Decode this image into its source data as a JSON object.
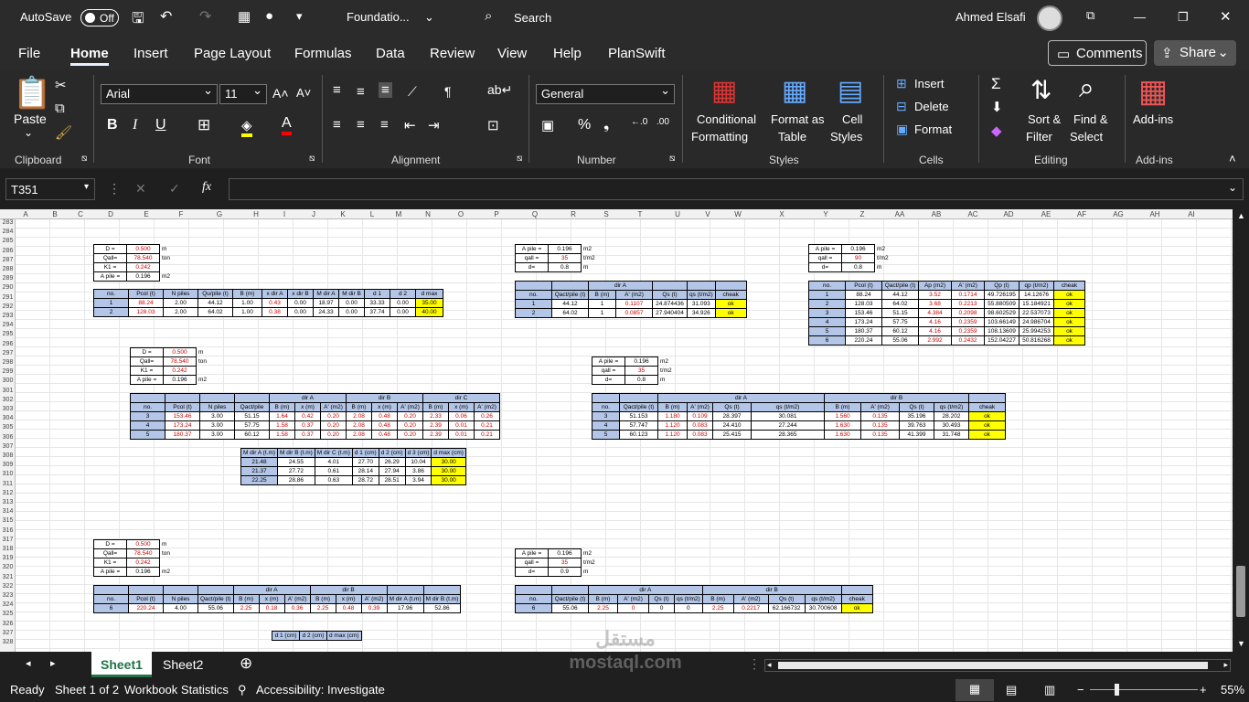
{
  "titlebar": {
    "autosave": "AutoSave",
    "toggle": "Off",
    "filename": "Foundatio...",
    "search": "Search",
    "user": "Ahmed Elsafi"
  },
  "menu": [
    "File",
    "Home",
    "Insert",
    "Page Layout",
    "Formulas",
    "Data",
    "Review",
    "View",
    "Help",
    "PlanSwift"
  ],
  "comments": "Comments",
  "share": "Share",
  "ribbon": {
    "paste": "Paste",
    "clipboard": "Clipboard",
    "font_name": "Arial",
    "font_size": "11",
    "font": "Font",
    "alignment": "Alignment",
    "number_format": "General",
    "number": "Number",
    "cond1": "Conditional",
    "cond2": "Formatting",
    "fmt1": "Format as",
    "fmt2": "Table",
    "cell1": "Cell",
    "cell2": "Styles",
    "styles": "Styles",
    "insert": "Insert",
    "delete": "Delete",
    "format": "Format",
    "cells": "Cells",
    "sort1": "Sort &",
    "sort2": "Filter",
    "find1": "Find &",
    "find2": "Select",
    "editing": "Editing",
    "addins": "Add-ins",
    "addins_group": "Add-ins"
  },
  "namebox": "T351",
  "fx": "fx",
  "columns": [
    "A",
    "B",
    "C",
    "D",
    "E",
    "F",
    "G",
    "H",
    "I",
    "J",
    "K",
    "L",
    "M",
    "N",
    "O",
    "P",
    "Q",
    "R",
    "S",
    "T",
    "U",
    "V",
    "W",
    "X",
    "Y",
    "Z",
    "AA",
    "AB",
    "AC",
    "AD",
    "AE",
    "AF",
    "AG",
    "AH",
    "AI"
  ],
  "rows": [
    "283",
    "284",
    "285",
    "286",
    "287",
    "288",
    "289",
    "290",
    "291",
    "292",
    "293",
    "294",
    "295",
    "296",
    "297",
    "298",
    "299",
    "300",
    "301",
    "302",
    "303",
    "304",
    "305",
    "306",
    "307",
    "308",
    "309",
    "310",
    "311",
    "312",
    "313",
    "314",
    "315",
    "316",
    "317",
    "318",
    "319",
    "320",
    "321",
    "322",
    "323",
    "324",
    "325",
    "326",
    "327",
    "328"
  ],
  "blocks": {
    "b1": {
      "labels": [
        "D =",
        "Qall=",
        "K1 =",
        "A pile ="
      ],
      "values": [
        "0.500",
        "78.540",
        "0.242",
        "0.196"
      ],
      "units": [
        "m",
        "ton",
        "",
        "m2"
      ]
    },
    "t1h": [
      "no.",
      "Pcol (t)",
      "N piles",
      "Qu/pile (t)",
      "B (m)",
      "x dir A",
      "x dir B",
      "M dir A",
      "M dir B",
      "d 1",
      "d 2",
      "d max"
    ],
    "t1": [
      [
        "1",
        "88.24",
        "2.00",
        "44.12",
        "1.00",
        "0.43",
        "0.00",
        "18.97",
        "0.00",
        "33.33",
        "0.00",
        "35.00"
      ],
      [
        "2",
        "128.03",
        "2.00",
        "64.02",
        "1.00",
        "0.38",
        "0.00",
        "24.33",
        "0.00",
        "37.74",
        "0.00",
        "40.00"
      ]
    ],
    "b2": {
      "labels": [
        "A pile =",
        "qall =",
        "d="
      ],
      "values": [
        "0.196",
        "35",
        "0.8"
      ],
      "units": [
        "m2",
        "t/m2",
        "m"
      ]
    },
    "t2h": [
      "no.",
      "Qact/pile (t)",
      "B (m)",
      "A' (m2)",
      "Qs (t)",
      "qs (t/m2)",
      "cheak"
    ],
    "t2": [
      [
        "1",
        "44.12",
        "1",
        "0.1107",
        "24.874436",
        "31.093",
        "ok"
      ],
      [
        "2",
        "64.02",
        "1",
        "0.0857",
        "27.940404",
        "34.926",
        "ok"
      ]
    ],
    "b3": {
      "labels": [
        "A pile =",
        "qall =",
        "d="
      ],
      "values": [
        "0.196",
        "90",
        "0.8"
      ],
      "units": [
        "m2",
        "t/m2",
        "m"
      ]
    },
    "t3h": [
      "no.",
      "Pcol (t)",
      "Qact/pile (t)",
      "Ap (m2)",
      "A' (m2)",
      "Qp (t)",
      "qp (t/m2)",
      "cheak"
    ],
    "t3": [
      [
        "1",
        "88.24",
        "44.12",
        "3.52",
        "0.1714",
        "49.726195",
        "14.12676",
        "ok"
      ],
      [
        "2",
        "128.03",
        "64.02",
        "3.68",
        "0.2213",
        "55.880509",
        "15.184921",
        "ok"
      ],
      [
        "3",
        "153.46",
        "51.15",
        "4.384",
        "0.2098",
        "98.602529",
        "22.537073",
        "ok"
      ],
      [
        "4",
        "173.24",
        "57.75",
        "4.16",
        "0.2359",
        "103.66149",
        "24.986704",
        "ok"
      ],
      [
        "5",
        "180.37",
        "60.12",
        "4.16",
        "0.2359",
        "108.13609",
        "25.994253",
        "ok"
      ],
      [
        "6",
        "220.24",
        "55.06",
        "2.992",
        "0.2432",
        "152.04227",
        "50.816268",
        "ok"
      ]
    ],
    "b4": {
      "labels": [
        "D =",
        "Qall=",
        "K1 =",
        "A pile ="
      ],
      "values": [
        "0.500",
        "78.540",
        "0.242",
        "0.196"
      ],
      "units": [
        "m",
        "ton",
        "",
        "m2"
      ]
    },
    "t4h": [
      "no.",
      "Pcol (t)",
      "N piles",
      "Qact/pile",
      "B (m)",
      "x (m)",
      "A' (m2)",
      "B (m)",
      "x (m)",
      "A' (m2)",
      "B (m)",
      "x (m)",
      "A' (m2)"
    ],
    "t4": [
      [
        "3",
        "153.46",
        "3.00",
        "51.15",
        "1.64",
        "0.42",
        "0.20",
        "2.08",
        "0.48",
        "0.20",
        "2.33",
        "0.06",
        "0.26"
      ],
      [
        "4",
        "173.24",
        "3.00",
        "57.75",
        "1.58",
        "0.37",
        "0.20",
        "2.08",
        "0.48",
        "0.20",
        "2.39",
        "0.01",
        "0.21"
      ],
      [
        "5",
        "180.37",
        "3.00",
        "60.12",
        "1.58",
        "0.37",
        "0.20",
        "2.08",
        "0.48",
        "0.20",
        "2.39",
        "0.01",
        "0.21"
      ]
    ],
    "t5h": [
      "M dir A (t.m)",
      "M dir B (t.m)",
      "M dir C (t.m)",
      "d 1 (cm)",
      "d 2 (cm)",
      "d 3 (cm)",
      "d max (cm)"
    ],
    "t5": [
      [
        "21.48",
        "24.55",
        "4.01",
        "27.70",
        "26.29",
        "10.04",
        "30.00"
      ],
      [
        "21.37",
        "27.72",
        "0.61",
        "28.14",
        "27.94",
        "3.86",
        "30.00"
      ],
      [
        "22.25",
        "28.86",
        "0.63",
        "28.72",
        "28.51",
        "3.94",
        "30.00"
      ]
    ],
    "b5": {
      "labels": [
        "A pile =",
        "qall =",
        "d="
      ],
      "values": [
        "0.196",
        "35",
        "0.8"
      ],
      "units": [
        "m2",
        "t/m2",
        "m"
      ]
    },
    "t6h": [
      "no.",
      "Qact/pile (t)",
      "B (m)",
      "A' (m2)",
      "Qs (t)",
      "qs (t/m2)",
      "B (m)",
      "A' (m2)",
      "Qs (t)",
      "qs (t/m2)",
      "cheak"
    ],
    "t6": [
      [
        "3",
        "51.153",
        "1.180",
        "0.109",
        "28.397",
        "30.081",
        "1.560",
        "0.135",
        "35.196",
        "28.202",
        "ok"
      ],
      [
        "4",
        "57.747",
        "1.120",
        "0.083",
        "24.410",
        "27.244",
        "1.630",
        "0.135",
        "39.763",
        "30.493",
        "ok"
      ],
      [
        "5",
        "60.123",
        "1.120",
        "0.083",
        "25.415",
        "28.365",
        "1.630",
        "0.135",
        "41.399",
        "31.748",
        "ok"
      ]
    ],
    "b6": {
      "labels": [
        "D =",
        "Qall=",
        "K1 =",
        "A pile ="
      ],
      "values": [
        "0.500",
        "78.540",
        "0.242",
        "0.196"
      ],
      "units": [
        "m",
        "ton",
        "",
        "m2"
      ]
    },
    "t7h": [
      "no.",
      "Pcol (t)",
      "N piles",
      "Qact/pile (t)",
      "B (m)",
      "x (m)",
      "A' (m2)",
      "B (m)",
      "x (m)",
      "A' (m2)",
      "M dir A (t.m)",
      "M dir B (t.m)"
    ],
    "t7": [
      [
        "6",
        "220.24",
        "4.00",
        "55.06",
        "2.25",
        "0.18",
        "0.36",
        "2.25",
        "0.48",
        "0.39",
        "17.96",
        "52.86"
      ]
    ],
    "t7b": [
      "d 1 (cm)",
      "d 2 (cm)",
      "d max (cm)"
    ],
    "b7": {
      "labels": [
        "A pile =",
        "qall =",
        "d="
      ],
      "values": [
        "0.196",
        "35",
        "0.9"
      ],
      "units": [
        "m2",
        "t/m2",
        "m"
      ]
    },
    "t8h": [
      "no.",
      "Qact/pile (t)",
      "B (m)",
      "A' (m2)",
      "Qs (t)",
      "qs (t/m2)",
      "B (m)",
      "A' (m2)",
      "Qs (t)",
      "qs (t/m2)",
      "cheak"
    ],
    "t8": [
      [
        "6",
        "55.06",
        "2.25",
        "0",
        "0",
        "0",
        "2.25",
        "0.2217",
        "62.166732",
        "30.700608",
        "ok"
      ]
    ],
    "dirA": "dir A",
    "dirB": "dir B",
    "dirC": "dir C"
  },
  "sheets": [
    "Sheet1",
    "Sheet2"
  ],
  "status": {
    "ready": "Ready",
    "sheet": "Sheet 1 of 2",
    "stats": "Workbook Statistics",
    "access": "Accessibility: Investigate",
    "zoom": "55%"
  },
  "watermark": "مستقل",
  "watermark_url": "mostaql.com"
}
